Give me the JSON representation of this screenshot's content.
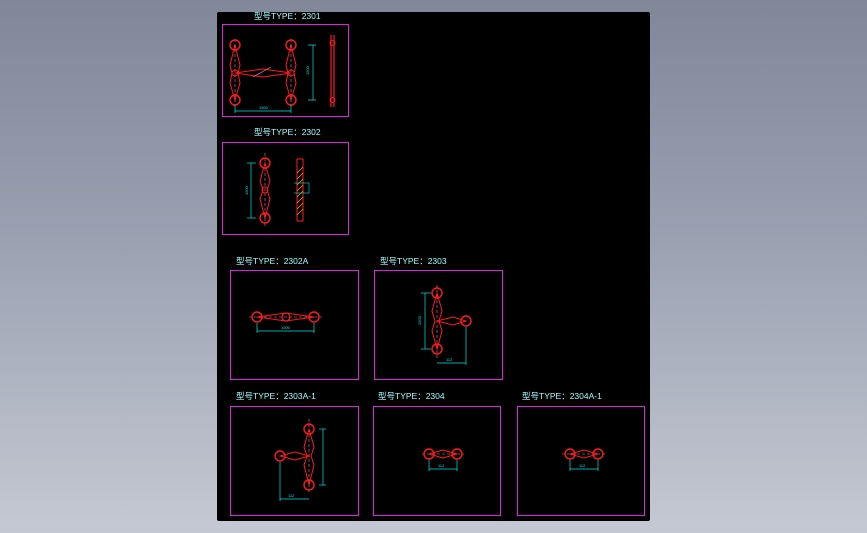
{
  "drawing": {
    "panels": [
      {
        "id": "2301",
        "label": "型号TYPE：2301",
        "dim_h": "1500",
        "dim_v": "1500"
      },
      {
        "id": "2302",
        "label": "型号TYPE：2302",
        "dim_v": "1500"
      },
      {
        "id": "2302A",
        "label": "型号TYPE：2302A",
        "dim_h": "1500"
      },
      {
        "id": "2303",
        "label": "型号TYPE：2303",
        "dim_h": "112",
        "dim_v": "1500"
      },
      {
        "id": "2303A-1",
        "label": "型号TYPE：2303A-1",
        "dim_h": "112"
      },
      {
        "id": "2304",
        "label": "型号TYPE：2304",
        "dim_h": "112"
      },
      {
        "id": "2304A-1",
        "label": "型号TYPE：2304A-1",
        "dim_h": "112"
      }
    ]
  },
  "colors": {
    "background": "#000000",
    "frame": "#e020e0",
    "part": "#ff1a1a",
    "dimension": "#00e5e5",
    "centerline": "#ff66cc",
    "hatch": "#ffb000"
  }
}
